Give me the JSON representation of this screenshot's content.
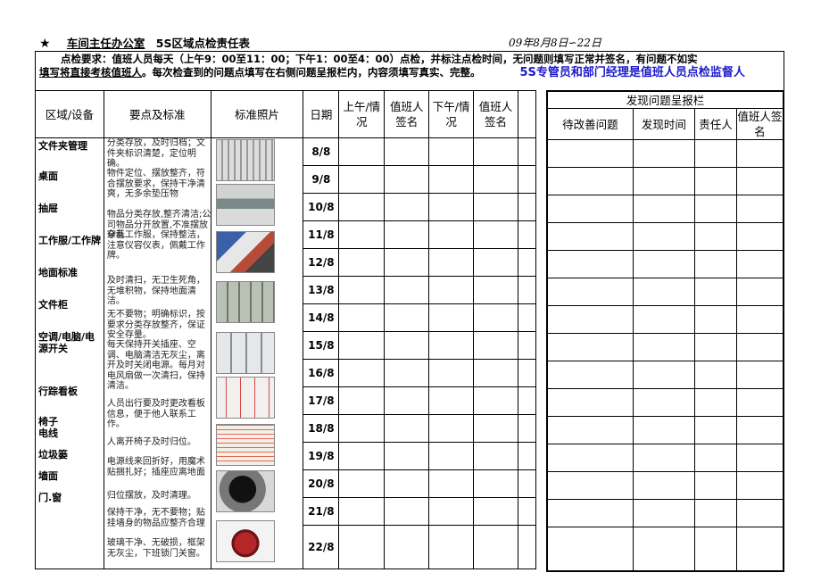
{
  "header": {
    "star": "★",
    "office": "车间主任办公室",
    "title": "5S区域点检责任表",
    "date_range": "09年8月8日∽22日"
  },
  "requirement": {
    "p1": "点检要求：值班人员每天（上午9：00至11：00；下午1：00至4：00）点检，并标注点检时间，无问题则填写正常并签名，有问题不如实",
    "p2a": "填写将直接考",
    "p2b": "核值班人",
    "p2c": "。每次检查到的问题点填写在右侧问题呈报栏内，内容须填写真实、完整。",
    "blue": "5S专管员和部门经理是值班人员点检监督人"
  },
  "columns": {
    "area": "区域/设备",
    "standard": "要点及标准",
    "photo": "标准照片",
    "date": "日期",
    "am": "上午/情况",
    "am_sign": "值班人签名",
    "pm": "下午/情况",
    "pm_sign": "值班人签名"
  },
  "report": {
    "caption": "发现问题呈报栏",
    "problem": "待改善问题",
    "found_time": "发现时间",
    "owner": "责任人",
    "duty_sign": "值班人签名"
  },
  "areas": [
    "文件夹管理",
    "桌面",
    "抽屉",
    "工作服/工作牌",
    "地面标准",
    "文件柜",
    "空调/电脑/电源开关",
    "行踪看板",
    "椅子",
    "电线",
    "垃圾篓",
    "墙面",
    "门.窗"
  ],
  "standards": [
    "分类存放，及时归档；文件夹标识清楚，定位明确。",
    "物件定位、摆放整齐，符合摆放要求，保持干净清爽，无多余垫压物",
    "物品分类存放,整齐清洁;公司物品分开放置,不准摆放杂乱.",
    "穿着工作服，保持整洁，注意仪容仪表，佩戴工作牌。",
    "及时清扫，无卫生死角，无堆积物，保持地面清洁。",
    "无不要物；明确标识，按要求分类存放整齐，保证安全存量。",
    "每天保持开关插座、空调、电脑清洁无灰尘，离开及时关闭电源。每月对电风扇做一次清扫，保持清洁。",
    "人员出行要及时更改看板信息，便于他人联系工作。",
    "人离开椅子及时归位。",
    "电源线来回折好，用魔术贴捆扎好；插座应离地面",
    "归位摆放，及时清理。",
    "保持干净，无不要物；贴挂墙身的物品应整齐合理",
    "玻璃干净、无破损，框架无灰尘，下班锁门关窗。"
  ],
  "dates": [
    "8/8",
    "9/8",
    "10/8",
    "11/8",
    "12/8",
    "13/8",
    "14/8",
    "15/8",
    "16/8",
    "17/8",
    "18/8",
    "19/8",
    "20/8",
    "21/8",
    "22/8"
  ]
}
